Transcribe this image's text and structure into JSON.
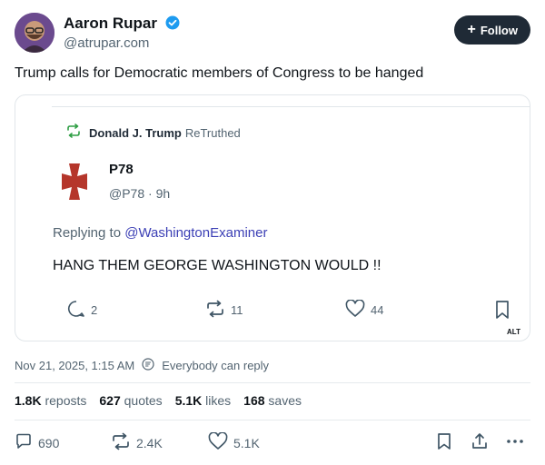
{
  "author": {
    "name": "Aaron Rupar",
    "handle": "@atrupar.com",
    "follow_label": "Follow"
  },
  "post_text": "Trump calls for Democratic members of Congress to be hanged",
  "embed": {
    "retruth_by": "Donald J. Trump",
    "retruth_label": "ReTruthed",
    "quoted_name": "P78",
    "quoted_handle": "@P78",
    "quoted_time": "9h",
    "replying_prefix": "Replying to",
    "replying_to": "@WashingtonExaminer",
    "quoted_text": "HANG THEM GEORGE WASHINGTON WOULD !!",
    "replies": "2",
    "retruths": "11",
    "likes": "44",
    "alt_badge": "ALT"
  },
  "meta": {
    "timestamp": "Nov 21, 2025, 1:15 AM",
    "reply_setting": "Everybody can reply"
  },
  "stats": {
    "reposts_count": "1.8K",
    "reposts_label": "reposts",
    "quotes_count": "627",
    "quotes_label": "quotes",
    "likes_count": "5.1K",
    "likes_label": "likes",
    "saves_count": "168",
    "saves_label": "saves"
  },
  "actions": {
    "replies": "690",
    "reposts": "2.4K",
    "likes": "5.1K"
  },
  "colors": {
    "accent_green": "#2e9e44",
    "link": "#3b3fb5",
    "muted": "#536471",
    "verified_blue": "#1d9bf0",
    "cross_red": "#b5362b"
  }
}
